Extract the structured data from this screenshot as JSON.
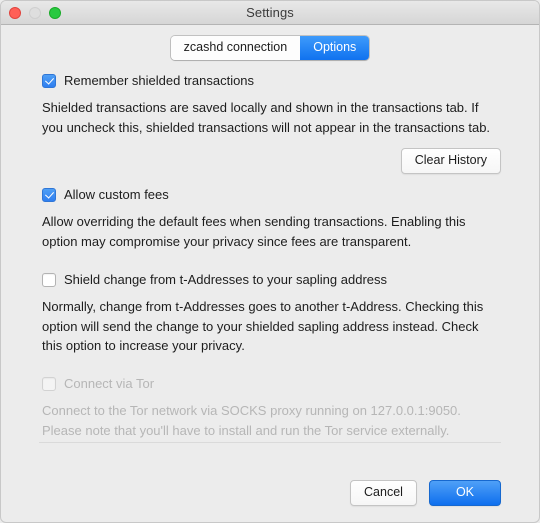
{
  "window": {
    "title": "Settings",
    "traffic_lights": [
      {
        "name": "close-button",
        "color": "#ff5f57"
      },
      {
        "name": "minimize-button",
        "color": "#dedede"
      },
      {
        "name": "zoom-button",
        "color": "#28c940"
      }
    ]
  },
  "tabs": [
    {
      "label": "zcashd connection",
      "active": false
    },
    {
      "label": "Options",
      "active": true
    }
  ],
  "sections": {
    "remember": {
      "checkbox_label": "Remember shielded transactions",
      "checked": true,
      "description": "Shielded transactions are saved locally and shown in the transactions tab. If you uncheck this, shielded transactions will not appear in the transactions tab.",
      "button_label": "Clear History"
    },
    "custom_fees": {
      "checkbox_label": "Allow custom fees",
      "checked": true,
      "description": "Allow overriding the default fees when sending transactions. Enabling this option may compromise your privacy since fees are transparent."
    },
    "shield_change": {
      "checkbox_label": "Shield change from t-Addresses to your sapling address",
      "checked": false,
      "description": "Normally, change from t-Addresses goes to another t-Address. Checking this option will send the change to your shielded sapling address instead. Check this option to increase your privacy."
    },
    "tor": {
      "checkbox_label": "Connect via Tor",
      "checked": false,
      "disabled": true,
      "description": "Connect to the Tor network via SOCKS proxy running on 127.0.0.1:9050. Please note that you'll have to install and run the Tor service externally."
    }
  },
  "footer": {
    "cancel_label": "Cancel",
    "ok_label": "OK"
  },
  "colors": {
    "accent": "#1072ef",
    "window_bg": "#ececec",
    "titlebar_bg": "#dcdcdc",
    "text": "#1d1d1d",
    "disabled_text": "#b6b6b6"
  }
}
